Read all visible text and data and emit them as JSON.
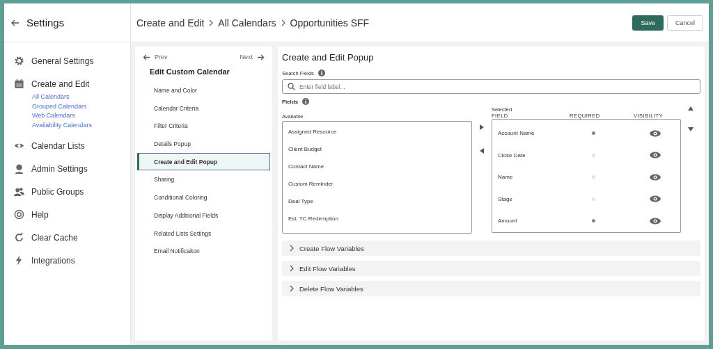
{
  "sidebar": {
    "title": "Settings",
    "items": [
      {
        "label": "General Settings"
      },
      {
        "label": "Create and Edit",
        "children": [
          {
            "label": "All Calendars"
          },
          {
            "label": "Grouped Calendars"
          },
          {
            "label": "Web Calendars"
          },
          {
            "label": "Availability Calendars"
          }
        ]
      },
      {
        "label": "Calendar Lists"
      },
      {
        "label": "Admin Settings"
      },
      {
        "label": "Public Groups"
      },
      {
        "label": "Help"
      },
      {
        "label": "Clear Cache"
      },
      {
        "label": "Integrations"
      }
    ]
  },
  "breadcrumb": [
    "Create and Edit",
    "All Calendars",
    "Opportunities SFF"
  ],
  "buttons": {
    "save": "Save",
    "cancel": "Cancel"
  },
  "steps": {
    "prev": "Prev",
    "next": "Next",
    "title": "Edit Custom Calendar",
    "items": [
      {
        "label": "Name and Color",
        "selected": false
      },
      {
        "label": "Calendar Criteria",
        "selected": false
      },
      {
        "label": "Filter Criteria",
        "selected": false
      },
      {
        "label": "Details Popup",
        "selected": false
      },
      {
        "label": "Create and Edit Popup",
        "selected": true
      },
      {
        "label": "Sharing",
        "selected": false
      },
      {
        "label": "Conditional Coloring",
        "selected": false
      },
      {
        "label": "Display Additional Fields",
        "selected": false
      },
      {
        "label": "Related Lists Settings",
        "selected": false
      },
      {
        "label": "Email Notificaiton",
        "selected": false
      }
    ]
  },
  "panel": {
    "title": "Create and Edit Popup",
    "search_label": "Search Fields",
    "search": {
      "placeholder": "Enter field label..."
    },
    "fields_label": "Fields",
    "available_label": "Available",
    "available": [
      "Assigned Resource",
      "Client Budget",
      "Contact Name",
      "Custom Reminder",
      "Deal Type",
      "Est. TC Redemption"
    ],
    "selected_label": "Selected",
    "columns": [
      "FIELD",
      "REQUIRED",
      "VISIBILITY"
    ],
    "selected": [
      {
        "field": "Account Name",
        "required": true,
        "visible": true
      },
      {
        "field": "Close Date",
        "required": false,
        "visible": true
      },
      {
        "field": "Name",
        "required": false,
        "visible": true
      },
      {
        "field": "Stage",
        "required": false,
        "visible": true
      },
      {
        "field": "Amount",
        "required": true,
        "visible": true
      }
    ],
    "sections": [
      {
        "label": "Create Flow Variables",
        "expanded": false
      },
      {
        "label": "Edit Flow Variables",
        "expanded": false
      },
      {
        "label": "Delete Flow Variables",
        "expanded": false
      }
    ]
  }
}
